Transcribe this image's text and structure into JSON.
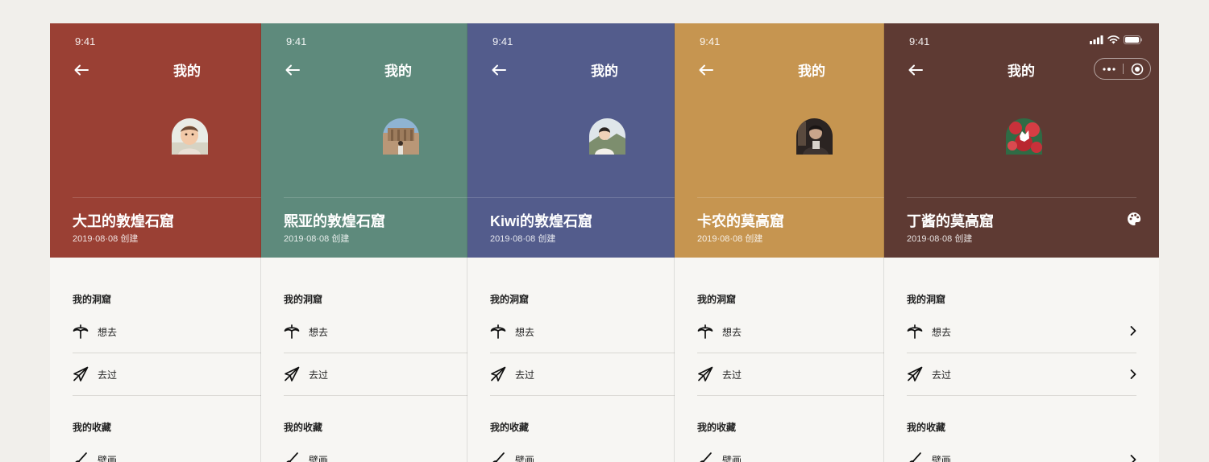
{
  "screen": {
    "time": "9:41",
    "title": "我的"
  },
  "phones": [
    {
      "color": "#9a4034",
      "name": "大卫的敦煌石窟",
      "date": "2019·08·08 创建"
    },
    {
      "color": "#5e8a7c",
      "name": "熙亚的敦煌石窟",
      "date": "2019·08·08 创建"
    },
    {
      "color": "#535c8c",
      "name": "Kiwi的敦煌石窟",
      "date": "2019·08·08 创建"
    },
    {
      "color": "#c69550",
      "name": "卡农的莫高窟",
      "date": "2019·08·08 创建"
    },
    {
      "color": "#5e3a33",
      "name": "丁酱的莫高窟",
      "date": "2019·08·08 创建"
    }
  ],
  "sections": {
    "caves": {
      "title": "我的洞窟",
      "want": "想去",
      "been": "去过"
    },
    "collections": {
      "title": "我的收藏",
      "murals": "壁画"
    }
  },
  "icons": {
    "back": "arrow-left-icon",
    "more": "more-dots-icon",
    "close": "target-icon",
    "palette": "palette-icon",
    "want": "parasol-icon",
    "been": "paper-plane-icon",
    "murals": "paintbrush-icon",
    "chevron": "chevron-right-icon"
  }
}
